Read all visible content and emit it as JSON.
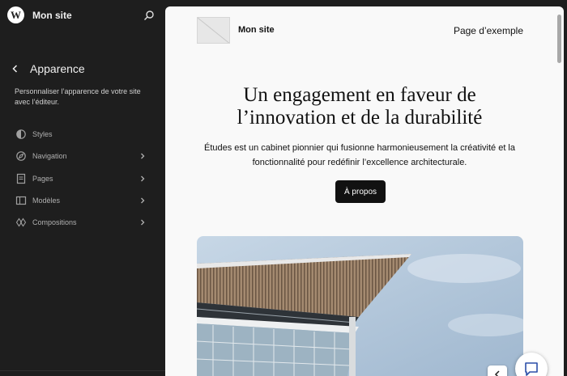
{
  "sidebar": {
    "site_name": "Mon site",
    "panel_title": "Apparence",
    "panel_description": "Personnaliser l’apparence de votre site avec l’éditeur.",
    "menu": [
      {
        "label": "Styles",
        "icon": "styles-icon",
        "has_chevron": false
      },
      {
        "label": "Navigation",
        "icon": "navigation-icon",
        "has_chevron": true
      },
      {
        "label": "Pages",
        "icon": "pages-icon",
        "has_chevron": true
      },
      {
        "label": "Modèles",
        "icon": "templates-icon",
        "has_chevron": true
      },
      {
        "label": "Compositions",
        "icon": "patterns-icon",
        "has_chevron": true
      }
    ]
  },
  "canvas": {
    "site_title": "Mon site",
    "nav_link": "Page d’exemple",
    "hero_title": "Un engagement en faveur de l’innovation et de la durabilité",
    "hero_text": "Études est un cabinet pionnier qui fusionne harmonieusement la créativité et la fonctionnalité pour redéfinir l’excellence architecturale.",
    "button_label": "À propos"
  },
  "colors": {
    "sidebar_bg": "#1e1e1e",
    "canvas_bg": "#f9f9f9",
    "button_bg": "#111111",
    "sky": "#b8cde0"
  }
}
